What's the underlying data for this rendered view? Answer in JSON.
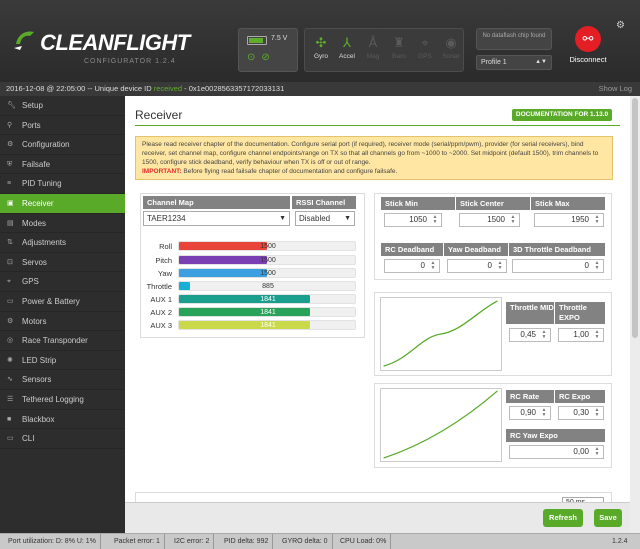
{
  "header": {
    "logo_text": "CLEANFLIGHT",
    "configurator_label": "CONFIGURATOR  1.2.4",
    "battery_voltage": "7.5 V",
    "sensors": [
      {
        "label": "Gyro",
        "icon": "gyro-icon",
        "active": true
      },
      {
        "label": "Accel",
        "icon": "accel-icon",
        "active": true
      },
      {
        "label": "Mag",
        "icon": "mag-icon",
        "active": false
      },
      {
        "label": "Baro",
        "icon": "baro-icon",
        "active": false
      },
      {
        "label": "GPS",
        "icon": "gps-icon",
        "active": false
      },
      {
        "label": "Sonar",
        "icon": "sonar-icon",
        "active": false
      }
    ],
    "dataflash_text": "No dataflash chip found",
    "profile_select": "Profile 1",
    "disconnect_label": "Disconnect",
    "disconnect_color": "#e31e24"
  },
  "status": {
    "prefix": "2016-12-08 @ 22:05:00 -- Unique device ID ",
    "received": "received",
    "suffix": " - 0x1e0028563357172033131",
    "show_log": "Show Log"
  },
  "sidebar": {
    "items": [
      {
        "label": "Setup",
        "icon": "wrench-icon"
      },
      {
        "label": "Ports",
        "icon": "plug-icon"
      },
      {
        "label": "Configuration",
        "icon": "gear-icon"
      },
      {
        "label": "Failsafe",
        "icon": "shield-icon"
      },
      {
        "label": "PID Tuning",
        "icon": "sliders-icon"
      },
      {
        "label": "Receiver",
        "icon": "receiver-icon",
        "active": true
      },
      {
        "label": "Modes",
        "icon": "modes-icon"
      },
      {
        "label": "Adjustments",
        "icon": "adjust-icon"
      },
      {
        "label": "Servos",
        "icon": "servo-icon"
      },
      {
        "label": "GPS",
        "icon": "gps-icon"
      },
      {
        "label": "Power & Battery",
        "icon": "battery-icon"
      },
      {
        "label": "Motors",
        "icon": "motor-icon"
      },
      {
        "label": "Race Transponder",
        "icon": "transponder-icon"
      },
      {
        "label": "LED Strip",
        "icon": "led-icon"
      },
      {
        "label": "Sensors",
        "icon": "sensors-icon"
      },
      {
        "label": "Tethered Logging",
        "icon": "log-icon"
      },
      {
        "label": "Blackbox",
        "icon": "blackbox-icon"
      },
      {
        "label": "CLI",
        "icon": "cli-icon"
      }
    ]
  },
  "page": {
    "title": "Receiver",
    "doc_button": "DOCUMENTATION FOR 1.13.0",
    "note_text": "Please read receiver chapter of the documentation. Configure serial port (if required), receiver mode (serial/ppm/pwm), provider (for serial receivers), bind receiver, set channel map, configure channel endpoints/range on TX so that all channels go from ~1000 to ~2000. Set midpoint (default 1500), trim channels to 1500, configure stick deadband, verify behaviour when TX is off or out of range.",
    "note_important_label": "IMPORTANT:",
    "note_important_text": " Before flying read failsafe chapter of documentation and configure failsafe.",
    "channel_map_header": "Channel Map",
    "rssi_header": "RSSI Channel",
    "channel_map_value": "TAER1234",
    "rssi_value": "Disabled",
    "channels": [
      {
        "name": "Roll",
        "value": 1500,
        "color": "#e8443a"
      },
      {
        "name": "Pitch",
        "value": 1500,
        "color": "#7b3fb4"
      },
      {
        "name": "Yaw",
        "value": 1500,
        "color": "#3b9fe0"
      },
      {
        "name": "Throttle",
        "value": 885,
        "color": "#17b0d4"
      },
      {
        "name": "AUX 1",
        "value": 1841,
        "color": "#1a9e8e"
      },
      {
        "name": "AUX 2",
        "value": 1841,
        "color": "#2aa35a"
      },
      {
        "name": "AUX 3",
        "value": 1841,
        "color": "#c9d94a"
      }
    ],
    "stick": {
      "min_label": "Stick Min",
      "center_label": "Stick Center",
      "max_label": "Stick Max",
      "min": "1050",
      "center": "1500",
      "max": "1950"
    },
    "deadband": {
      "rc_label": "RC Deadband",
      "yaw_label": "Yaw Deadband",
      "throttle_label": "3D Throttle Deadband",
      "rc": "0",
      "yaw": "0",
      "throttle": "0"
    },
    "throttle": {
      "mid_label": "Throttle MID",
      "expo_label": "Throttle EXPO",
      "mid": "0,45",
      "expo": "1,00"
    },
    "rates": {
      "rc_rate_label": "RC Rate",
      "rc_expo_label": "RC Expo",
      "yaw_expo_label": "RC Yaw Expo",
      "rc_rate": "0,90",
      "rc_expo": "0,30",
      "yaw_expo": "0,00"
    },
    "refresh_rate": "50 ms",
    "refresh_button": "Refresh",
    "save_button": "Save"
  },
  "footer": {
    "port_util": "Port utilization: D: 8% U: 1%",
    "packet_error": "Packet error: 1",
    "i2c_error": "I2C error: 2",
    "pid_delta": "PID delta: 992",
    "gyro_delta": "GYRO delta: 0",
    "cpu_load": "CPU Load: 0%",
    "version": "1.2.4"
  }
}
